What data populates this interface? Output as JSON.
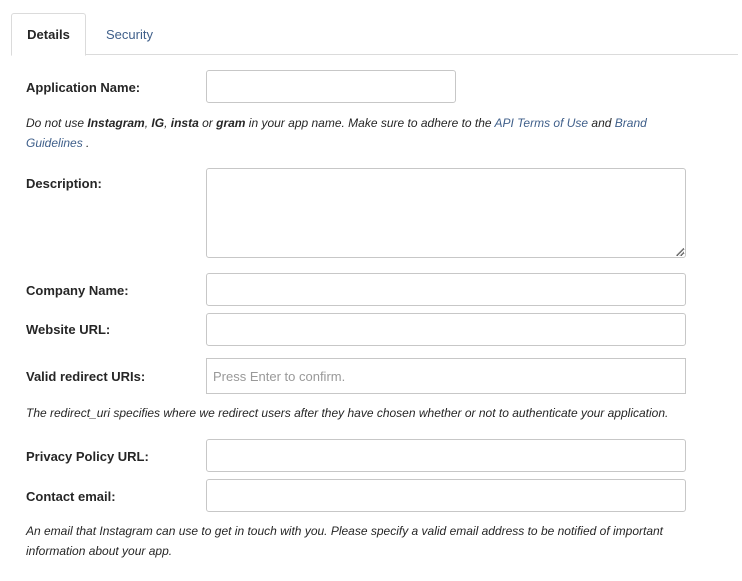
{
  "tabs": [
    {
      "label": "Details",
      "active": true
    },
    {
      "label": "Security",
      "active": false
    }
  ],
  "form": {
    "app_name": {
      "label": "Application Name:",
      "value": ""
    },
    "app_name_help": {
      "p1": "Do not use ",
      "b1": "Instagram",
      "p2": ", ",
      "b2": "IG",
      "p3": ", ",
      "b3": "insta",
      "p4": " or ",
      "b4": "gram",
      "p5": " in your app name. Make sure to adhere to the ",
      "link1": "API Terms of Use",
      "p6": " and ",
      "link2": "Brand Guidelines",
      "p7": " ."
    },
    "description": {
      "label": "Description:",
      "value": ""
    },
    "company_name": {
      "label": "Company Name:",
      "value": ""
    },
    "website_url": {
      "label": "Website URL:",
      "value": ""
    },
    "redirect_uris": {
      "label": "Valid redirect URIs:",
      "placeholder": "Press Enter to confirm."
    },
    "redirect_help": "The redirect_uri specifies where we redirect users after they have chosen whether or not to authenticate your application.",
    "privacy_url": {
      "label": "Privacy Policy URL:",
      "value": ""
    },
    "contact_email": {
      "label": "Contact email:",
      "value": ""
    },
    "contact_help": "An email that Instagram can use to get in touch with you. Please specify a valid email address to be notified of important information about your app."
  },
  "colors": {
    "link": "#3f5f8a",
    "border": "#c7c7c7",
    "text": "#262626",
    "placeholder": "#999999"
  }
}
